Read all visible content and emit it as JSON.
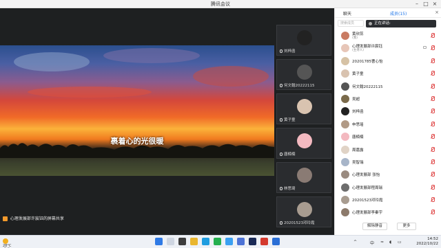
{
  "window": {
    "title": "腾讯会议"
  },
  "stage": {
    "caption": "裹着心的光很暖",
    "share_status": "心理发展部许宸钰的屏幕共享"
  },
  "tiles": [
    {
      "name": "刘梓函",
      "avatar": "#222"
    },
    {
      "name": "何文翰20222115",
      "avatar": "#555"
    },
    {
      "name": "黄子童",
      "avatar": "#d9c3b0"
    },
    {
      "name": "唐楠楠",
      "avatar": "#f3b9c0"
    },
    {
      "name": "林思琦",
      "avatar": "#8a7b74"
    },
    {
      "name": "20201523邓玲霞",
      "avatar": "#a89c90"
    }
  ],
  "panel": {
    "tab_chat": "聊天",
    "tab_members": "成员(15)",
    "search_placeholder": "搜索成员",
    "toast": "正在讲话:",
    "members": [
      {
        "name": "黄欣蕊",
        "sub": "(我)",
        "avatar": "#c97b63"
      },
      {
        "name": "心理发展部许宸钰",
        "sub": "(主持人)",
        "avatar": "#e7c6b8"
      },
      {
        "name": "20201785曹心怡",
        "sub": "",
        "avatar": "#d6c2a5"
      },
      {
        "name": "黄子童",
        "sub": "",
        "avatar": "#d9c3b0"
      },
      {
        "name": "何文翰20222115",
        "sub": "",
        "avatar": "#555"
      },
      {
        "name": "吴超",
        "sub": "",
        "avatar": "#7a6a4a"
      },
      {
        "name": "刘梓函",
        "sub": "",
        "avatar": "#222"
      },
      {
        "name": "申思瑶",
        "sub": "",
        "avatar": "#b19a86"
      },
      {
        "name": "唐楠楠",
        "sub": "",
        "avatar": "#f3b9c0"
      },
      {
        "name": "周嘉露",
        "sub": "",
        "avatar": "#e0d3c6"
      },
      {
        "name": "吴智瑞",
        "sub": "",
        "avatar": "#a7b5c9"
      },
      {
        "name": "心理发展部 张怡",
        "sub": "",
        "avatar": "#9a8b80"
      },
      {
        "name": "心理发展部程周瑞",
        "sub": "",
        "avatar": "#6d6d6d"
      },
      {
        "name": "20201523邓玲霞",
        "sub": "",
        "avatar": "#a89c90"
      },
      {
        "name": "心理发展部李秦宇",
        "sub": "",
        "avatar": "#8c7a6b"
      }
    ],
    "unmute_all": "解除静音",
    "more": "更多"
  },
  "taskbar": {
    "temp": "28°C",
    "weather": "晴朗",
    "ime": "中",
    "time": "14:52",
    "date": "2022/10/22"
  }
}
